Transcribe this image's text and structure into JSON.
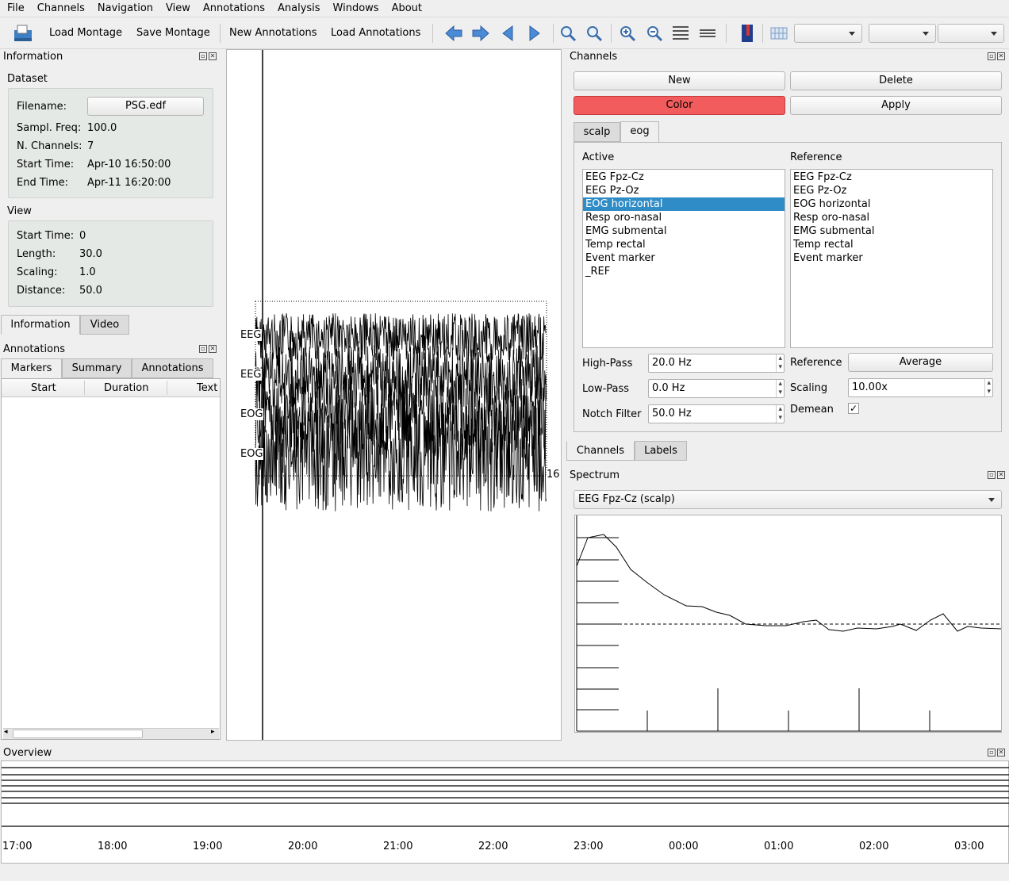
{
  "menu": [
    "File",
    "Channels",
    "Navigation",
    "View",
    "Annotations",
    "Analysis",
    "Windows",
    "About"
  ],
  "toolbar": {
    "load_montage": "Load Montage",
    "save_montage": "Save Montage",
    "new_annotations": "New Annotations",
    "load_annotations": "Load Annotations"
  },
  "information": {
    "title": "Information",
    "dataset_label": "Dataset",
    "filename_label": "Filename:",
    "filename": "PSG.edf",
    "sfreq_label": "Sampl. Freq:",
    "sfreq": "100.0",
    "nchan_label": "N. Channels:",
    "nchan": "7",
    "start_label": "Start Time:",
    "start": "Apr-10 16:50:00",
    "end_label": "End Time:",
    "end": "Apr-11 16:20:00",
    "view_label": "View",
    "vstart_label": "Start Time:",
    "vstart": "0",
    "length_label": "Length:",
    "length": "30.0",
    "scaling_label": "Scaling:",
    "scaling": "1.0",
    "distance_label": "Distance:",
    "distance": "50.0",
    "tab_info": "Information",
    "tab_video": "Video"
  },
  "annotations": {
    "title": "Annotations",
    "tabs": [
      "Markers",
      "Summary",
      "Annotations"
    ],
    "columns": [
      "Start",
      "Duration",
      "Text"
    ]
  },
  "plot": {
    "labels": [
      "EEG",
      "EEG",
      "EOG",
      "EOG"
    ],
    "time_label": "16:"
  },
  "channels": {
    "title": "Channels",
    "new": "New",
    "delete": "Delete",
    "color": "Color",
    "apply": "Apply",
    "tabs": [
      "scalp",
      "eog"
    ],
    "active_label": "Active",
    "reference_label": "Reference",
    "active": [
      "EEG Fpz-Cz",
      "EEG Pz-Oz",
      "EOG horizontal",
      "Resp oro-nasal",
      "EMG submental",
      "Temp rectal",
      "Event marker",
      "_REF"
    ],
    "reference": [
      "EEG Fpz-Cz",
      "EEG Pz-Oz",
      "EOG horizontal",
      "Resp oro-nasal",
      "EMG submental",
      "Temp rectal",
      "Event marker"
    ],
    "highpass_label": "High-Pass",
    "highpass": "20.0 Hz",
    "lowpass_label": "Low-Pass",
    "lowpass": "0.0 Hz",
    "notch_label": "Notch Filter",
    "notch": "50.0 Hz",
    "ref_label": "Reference",
    "ref_value": "Average",
    "scaling_label": "Scaling",
    "scaling": "10.00x",
    "demean_label": "Demean",
    "demean": "✓",
    "bottom_tabs": [
      "Channels",
      "Labels"
    ],
    "color_accent": "#f25c5c"
  },
  "spectrum": {
    "title": "Spectrum",
    "selected": "EEG Fpz-Cz (scalp)"
  },
  "overview": {
    "title": "Overview",
    "times": [
      "17:00",
      "18:00",
      "19:00",
      "20:00",
      "21:00",
      "22:00",
      "23:00",
      "00:00",
      "01:00",
      "02:00",
      "03:00"
    ]
  }
}
